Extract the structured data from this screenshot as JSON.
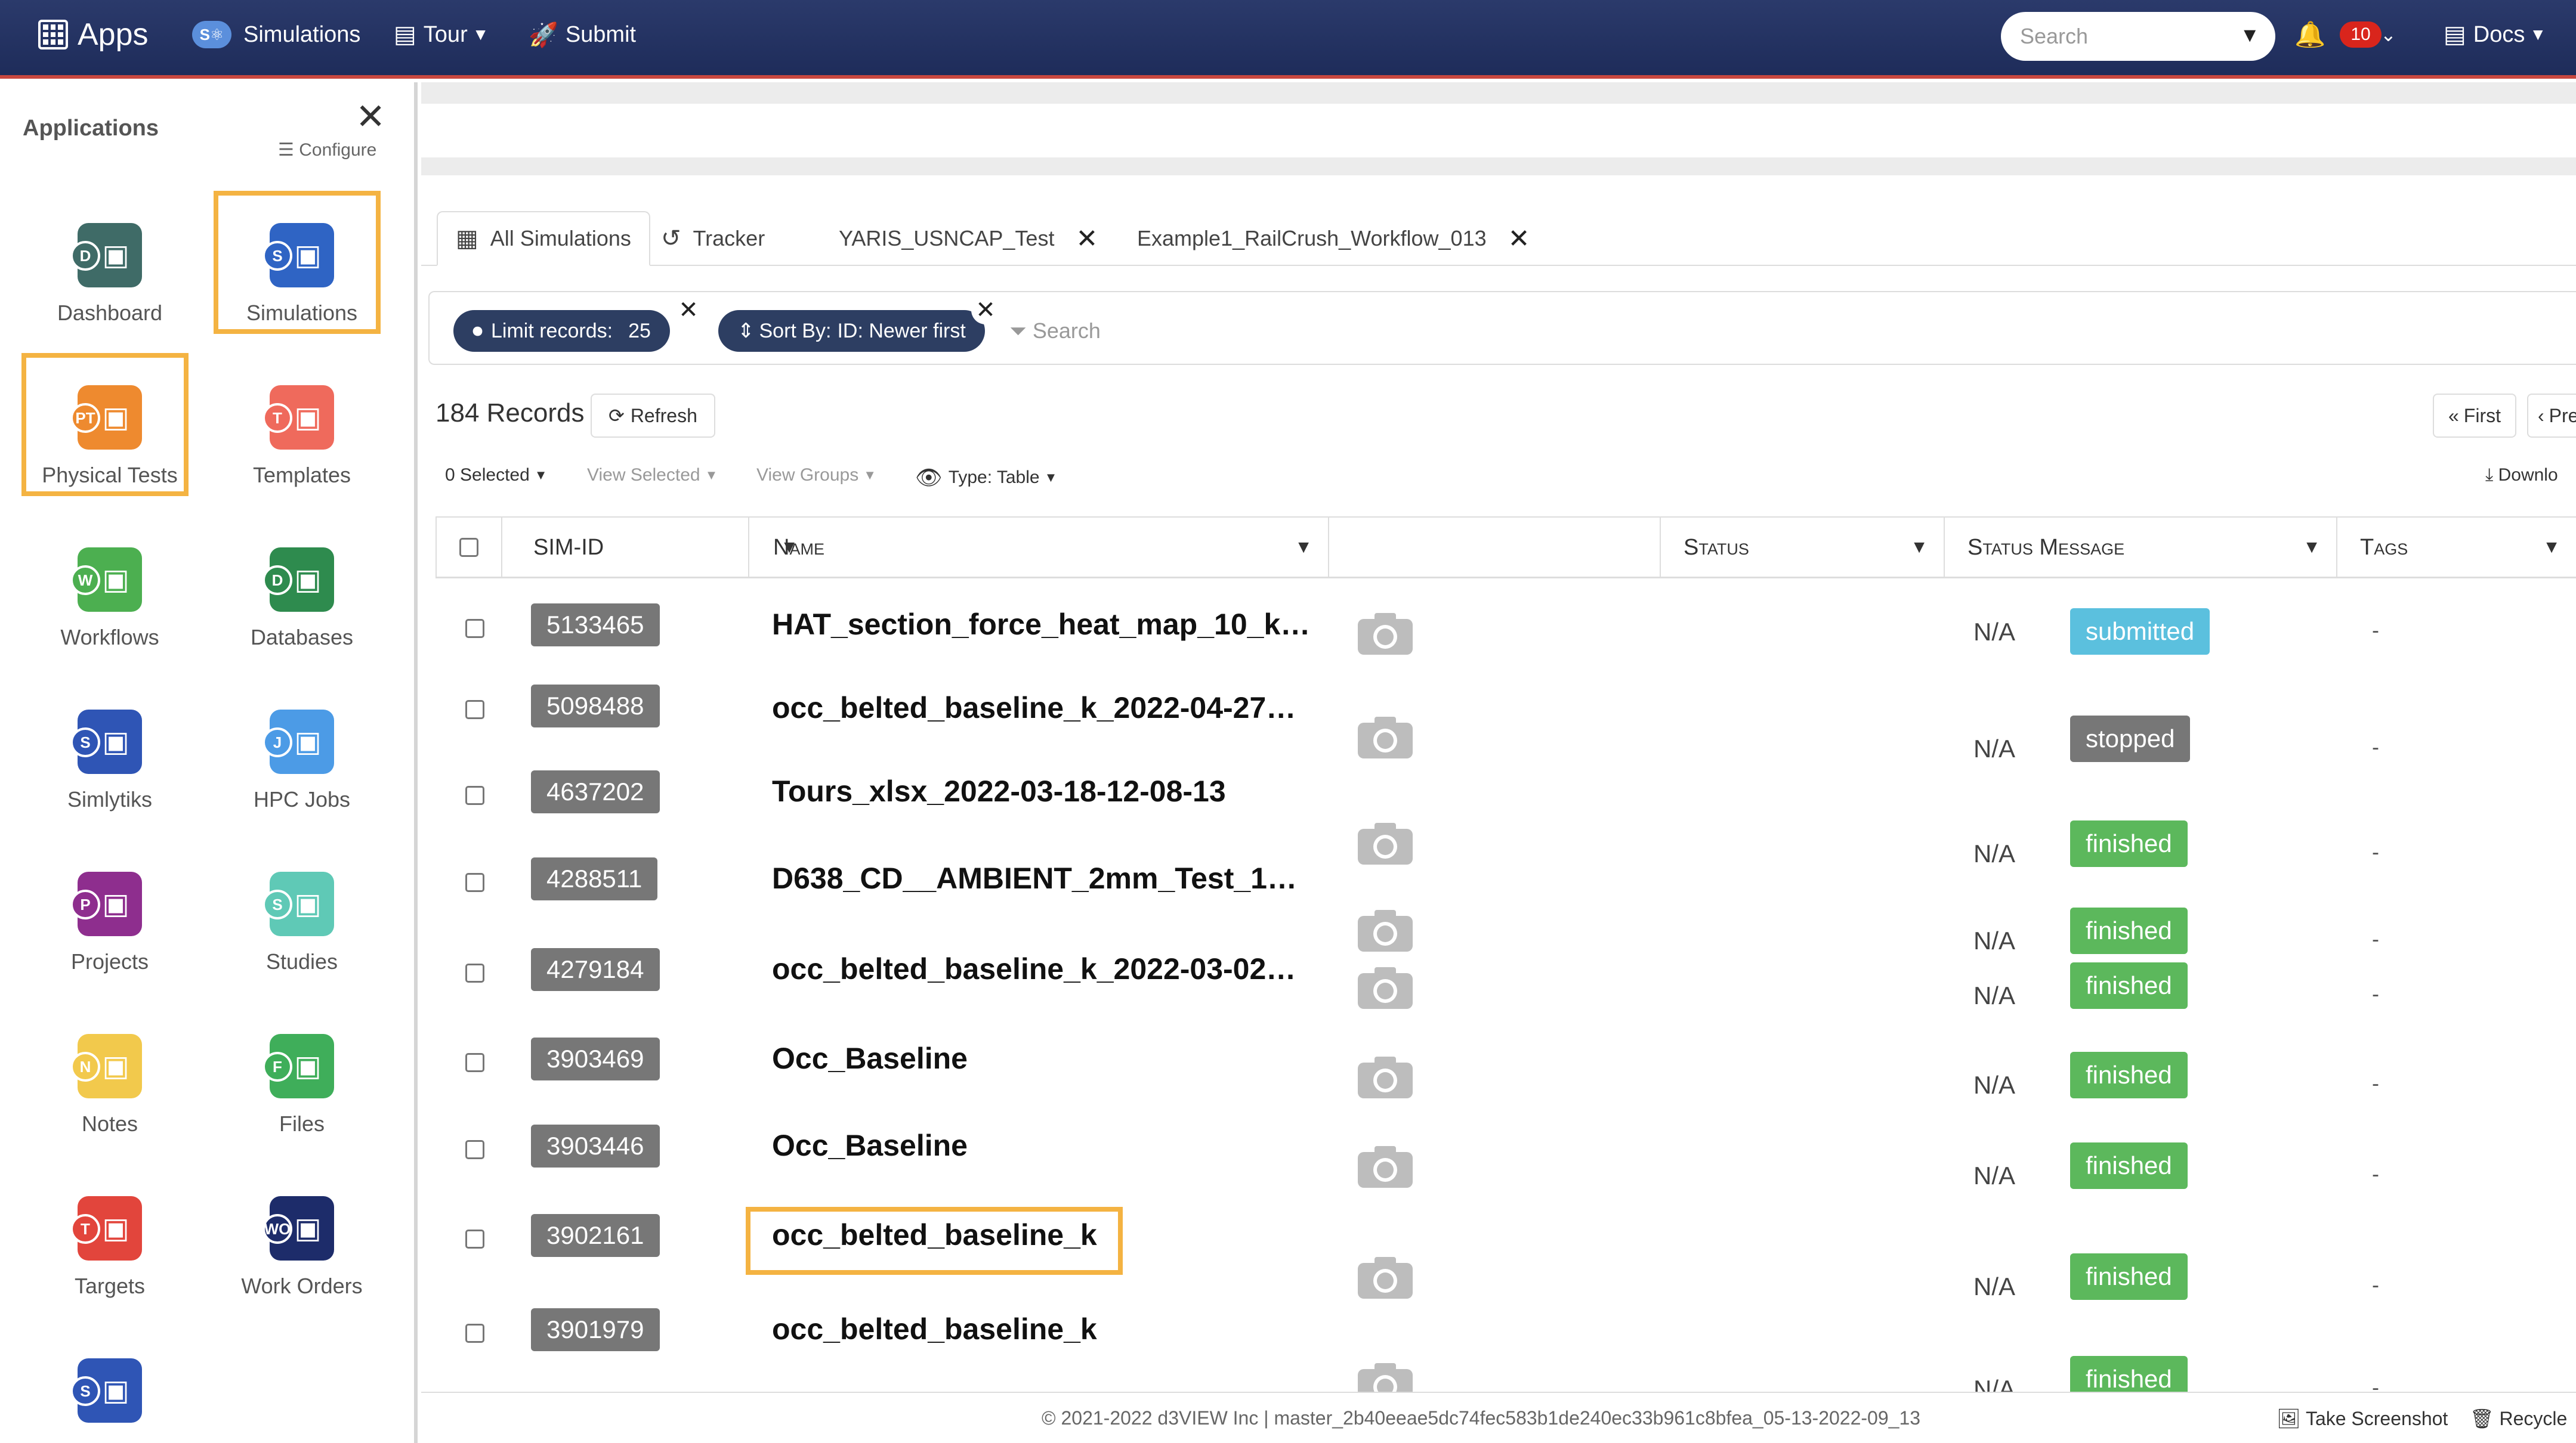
{
  "topbar": {
    "apps_label": "Apps",
    "sim_badge": "S⚛",
    "simulations_label": "Simulations",
    "tour_label": "Tour",
    "submit_label": "Submit",
    "search_placeholder": "Search",
    "notification_count": "10",
    "docs_label": "Docs"
  },
  "sidebar": {
    "title": "Applications",
    "configure_label": "Configure",
    "apps": [
      {
        "label": "Dashboard",
        "letter": "D",
        "color": "#3f6b67",
        "icon": "monitor-icon"
      },
      {
        "label": "Simulations",
        "letter": "S",
        "color": "#2f64c4",
        "icon": "atom-icon"
      },
      {
        "label": "Physical Tests",
        "letter": "PT",
        "color": "#ee8a2f",
        "icon": "flask-icon"
      },
      {
        "label": "Templates",
        "letter": "T",
        "color": "#ef6a5c",
        "icon": "template-icon"
      },
      {
        "label": "Workflows",
        "letter": "W",
        "color": "#4caf50",
        "icon": "workflow-icon"
      },
      {
        "label": "Databases",
        "letter": "D",
        "color": "#2e8b4e",
        "icon": "database-icon"
      },
      {
        "label": "Simlytiks",
        "letter": "S",
        "color": "#2f55b5",
        "icon": "analytics-icon"
      },
      {
        "label": "HPC Jobs",
        "letter": "J",
        "color": "#4c9be6",
        "icon": "rocket-icon"
      },
      {
        "label": "Projects",
        "letter": "P",
        "color": "#8e2e8e",
        "icon": "folder-icon"
      },
      {
        "label": "Studies",
        "letter": "S",
        "color": "#5fc9b6",
        "icon": "study-icon"
      },
      {
        "label": "Notes",
        "letter": "N",
        "color": "#f2c94c",
        "icon": "note-icon"
      },
      {
        "label": "Files",
        "letter": "F",
        "color": "#3fae5a",
        "icon": "files-icon"
      },
      {
        "label": "Targets",
        "letter": "T",
        "color": "#e2453c",
        "icon": "target-icon"
      },
      {
        "label": "Work Orders",
        "letter": "WO",
        "color": "#1d2c6a",
        "icon": "workorder-icon"
      },
      {
        "label": "",
        "letter": "S",
        "color": "#2f55b5",
        "icon": "analytics-icon"
      }
    ]
  },
  "tabs": {
    "all_simulations": "All Simulations",
    "tracker": "Tracker",
    "yaris": "YARIS_USNCAP_Test",
    "example": "Example1_RailCrush_Workflow_013"
  },
  "filters": {
    "limit_label": "Limit records:",
    "limit_value": "25",
    "sort_label": "Sort By:",
    "sort_value": "ID: Newer first",
    "search_placeholder": "Search"
  },
  "toolbar": {
    "records": "184 Records",
    "refresh": "Refresh",
    "first": "First",
    "prev": "Pre",
    "selected": "0 Selected",
    "view_selected": "View Selected",
    "view_groups": "View Groups",
    "type": "Type: Table",
    "download": "Downlo"
  },
  "table": {
    "columns": {
      "sim_id": "SIM-ID",
      "name": "Name",
      "status": "Status",
      "status_message": "Status Message",
      "tags": "Tags"
    },
    "rows": [
      {
        "sim_id": "5133465",
        "name": "HAT_section_force_heat_map_10_k…",
        "status": "submitted",
        "message": "N/A",
        "tags": "-"
      },
      {
        "sim_id": "5098488",
        "name": "occ_belted_baseline_k_2022-04-27…",
        "status": "stopped",
        "message": "N/A",
        "tags": "-"
      },
      {
        "sim_id": "4637202",
        "name": "Tours_xlsx_2022-03-18-12-08-13",
        "status": "finished",
        "message": "N/A",
        "tags": "-"
      },
      {
        "sim_id": "4288511",
        "name": "D638_CD__AMBIENT_2mm_Test_1…",
        "status": "finished",
        "message": "N/A",
        "tags": "-"
      },
      {
        "sim_id": "4279184",
        "name": "occ_belted_baseline_k_2022-03-02…",
        "status": "finished",
        "message": "N/A",
        "tags": "-"
      },
      {
        "sim_id": "3903469",
        "name": "Occ_Baseline",
        "status": "finished",
        "message": "N/A",
        "tags": "-"
      },
      {
        "sim_id": "3903446",
        "name": "Occ_Baseline",
        "status": "finished",
        "message": "N/A",
        "tags": "-"
      },
      {
        "sim_id": "3902161",
        "name": "occ_belted_baseline_k",
        "status": "finished",
        "message": "N/A",
        "tags": "-"
      },
      {
        "sim_id": "3901979",
        "name": "occ_belted_baseline_k",
        "status": "finished",
        "message": "N/A",
        "tags": "-"
      }
    ]
  },
  "footer": {
    "copyright": "© 2021-2022 d3VIEW Inc | master_2b40eeae5dc74fec583b1de240ec33b961c8bfea_05-13-2022-09_13",
    "screenshot": "Take Screenshot",
    "recycle": "Recycle"
  },
  "colors": {
    "topbar": "#1e2c5a",
    "accent_red": "#c8473f",
    "highlight": "#f4b342",
    "chip": "#2d3e62",
    "submitted": "#5bc0de",
    "stopped": "#777777",
    "finished": "#5cb85c"
  }
}
